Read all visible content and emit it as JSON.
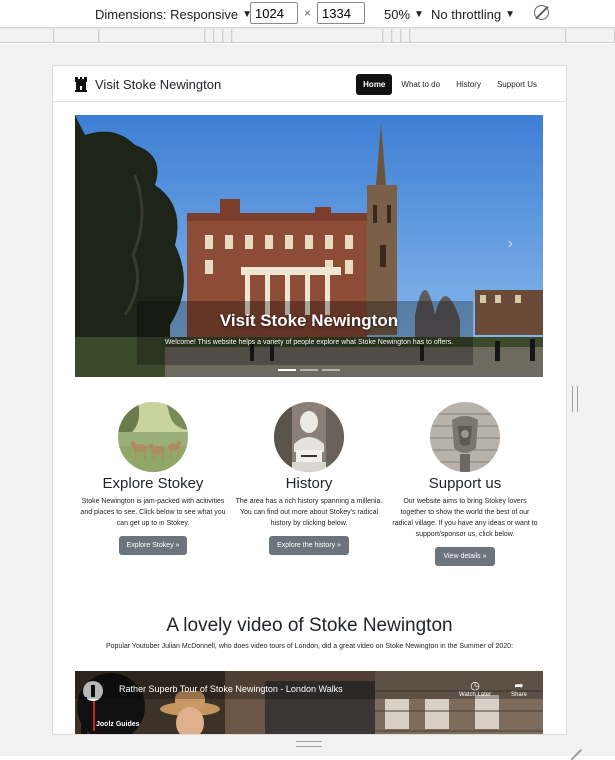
{
  "devtools": {
    "dimensions_label": "Dimensions: Responsive",
    "width": "1024",
    "height": "1334",
    "times": "×",
    "zoom": "50%",
    "throttling": "No throttling",
    "caret": "▼"
  },
  "site": {
    "brand": "Visit Stoke Newington",
    "nav": {
      "home": "Home",
      "todo": "What to do",
      "history": "History",
      "support": "Support Us"
    },
    "hero": {
      "title": "Visit Stoke Newington",
      "subtitle": "Welcome! This website helps a variety of people explore what Stoke Newington has to offers.",
      "next": "›"
    },
    "features": [
      {
        "title": "Explore Stokey",
        "text": "Stoke Newington is jam-packed with acitivities and places to see. Click below to see what you can get up to in Stokey.",
        "button": "Explore Stokey »"
      },
      {
        "title": "History",
        "text": "The area has a rich history spanning a millenia. You can find out more about Stokey's radical history by clicking below.",
        "button": "Explore the history »"
      },
      {
        "title": "Support us",
        "text": "Our website aims to bring Stokey lovers together to show the world the best of our radical village. If you have any ideas or want to support/sponsor us, click below.",
        "button": "View details »"
      }
    ],
    "video": {
      "heading": "A lovely video of Stoke Newington",
      "description": "Popular Youtuber Julian McDonnell, who does video tours of London, did a great video on Stoke Newington in the Summer of 2020:",
      "title": "Rather Superb Tour of Stoke Newington - London Walks",
      "watch_later": "Watch Later",
      "share": "Share",
      "channel": "Joolz Guides"
    }
  },
  "colors": {
    "nav_active": "#111111",
    "button": "#6c757d",
    "sky": "#4a87d6"
  }
}
